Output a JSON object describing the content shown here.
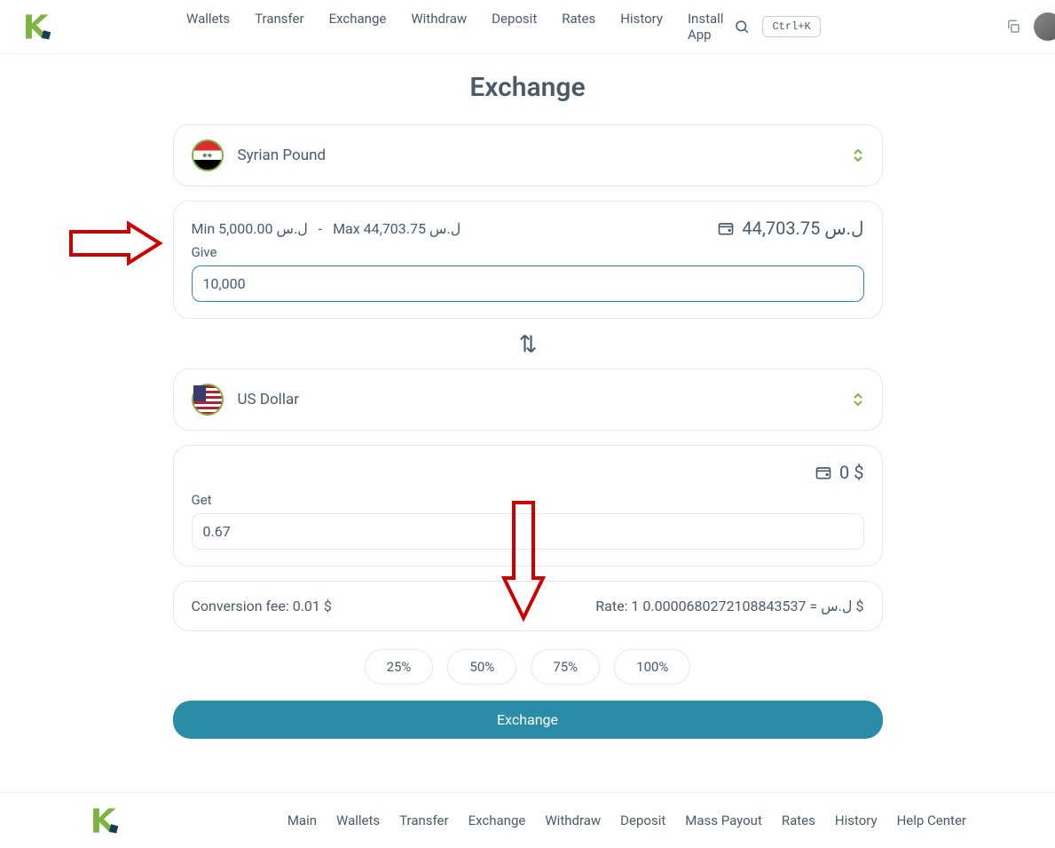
{
  "nav": [
    "Wallets",
    "Transfer",
    "Exchange",
    "Withdraw",
    "Deposit",
    "Rates",
    "History",
    "Install App"
  ],
  "shortcut": "Ctrl+K",
  "title": "Exchange",
  "give_currency": {
    "name": "Syrian Pound"
  },
  "give_limits": {
    "min": "Min 5,000.00 ل.س",
    "sep": "-",
    "max": "Max 44,703.75 ل.س"
  },
  "give_balance": "44,703.75 ل.س",
  "give_label": "Give",
  "give_value": "10,000",
  "get_currency": {
    "name": "US Dollar"
  },
  "get_balance": "0 $",
  "get_label": "Get",
  "get_value": "0.67",
  "fee_text": "Conversion fee: 0.01 $",
  "rate_text": "Rate: 1 ل.س = 0.0000680272108843537 $",
  "percents": [
    "25%",
    "50%",
    "75%",
    "100%"
  ],
  "exchange_btn": "Exchange",
  "footer_nav": [
    "Main",
    "Wallets",
    "Transfer",
    "Exchange",
    "Withdraw",
    "Deposit",
    "Mass Payout",
    "Rates",
    "History",
    "Help Center"
  ]
}
